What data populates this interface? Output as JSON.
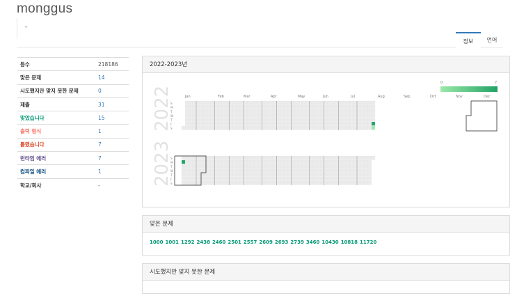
{
  "username": "monggus",
  "status_message": "-",
  "tabs": [
    {
      "label": "정보",
      "active": true
    },
    {
      "label": "언어",
      "active": false
    }
  ],
  "stats": [
    {
      "key": "등수",
      "value": "218186",
      "key_color": "#333333",
      "value_color": "#555555"
    },
    {
      "key": "맞은 문제",
      "value": "14",
      "key_color": "#333333",
      "value_color": "#337ab7"
    },
    {
      "key": "시도했지만 맞지 못한 문제",
      "value": "0",
      "key_color": "#333333",
      "value_color": "#337ab7"
    },
    {
      "key": "제출",
      "value": "31",
      "key_color": "#333333",
      "value_color": "#337ab7"
    },
    {
      "key": "맞았습니다",
      "value": "15",
      "key_color": "#009874",
      "value_color": "#337ab7"
    },
    {
      "key": "출력 형식",
      "value": "1",
      "key_color": "#fa7268",
      "value_color": "#337ab7"
    },
    {
      "key": "틀렸습니다",
      "value": "7",
      "key_color": "#dd4124",
      "value_color": "#337ab7"
    },
    {
      "key": "런타임 에러",
      "value": "7",
      "key_color": "#5f4b8b",
      "value_color": "#337ab7"
    },
    {
      "key": "컴파일 에러",
      "value": "1",
      "key_color": "#0f4c81",
      "value_color": "#337ab7"
    },
    {
      "key": "학교/회사",
      "value": "-",
      "key_color": "#333333",
      "value_color": "#555555"
    }
  ],
  "heatmap_panel": {
    "title": "2022-2023년",
    "legend_min": "0",
    "legend_max": "7",
    "months": [
      "Jan",
      "Feb",
      "Mar",
      "Apr",
      "May",
      "Jun",
      "Jul",
      "Aug",
      "Sep",
      "Oct",
      "Nov",
      "Dec"
    ],
    "weekdays": [
      "S",
      "M",
      "T",
      "W",
      "T",
      "F",
      "S"
    ],
    "years": [
      "2022",
      "2023"
    ],
    "colors": {
      "empty": "#ebebeb",
      "low": "#9be9a8",
      "high": "#21a366",
      "highlight_border": "#555555"
    }
  },
  "solved_panel": {
    "title": "맞은 문제",
    "problems": [
      "1000",
      "1001",
      "1292",
      "2438",
      "2460",
      "2501",
      "2557",
      "2609",
      "2693",
      "2739",
      "3460",
      "10430",
      "10818",
      "11720"
    ]
  },
  "failed_panel": {
    "title": "시도했지만 맞지 못한 문제"
  }
}
